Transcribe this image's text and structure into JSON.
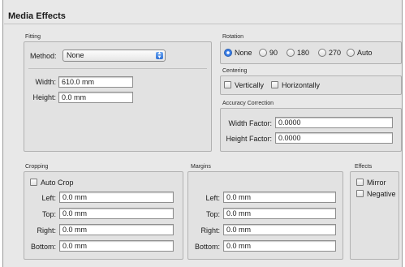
{
  "panel": {
    "title": "Media Effects"
  },
  "fitting": {
    "title": "Fitting",
    "method_label": "Method:",
    "method_value": "None",
    "width_label": "Width:",
    "width_value": "610.0 mm",
    "height_label": "Height:",
    "height_value": "0.0 mm"
  },
  "rotation": {
    "title": "Rotation",
    "options": [
      "None",
      "90",
      "180",
      "270",
      "Auto"
    ],
    "selected": "None"
  },
  "centering": {
    "title": "Centering",
    "vertically_label": "Vertically",
    "horizontally_label": "Horizontally"
  },
  "accuracy": {
    "title": "Accuracy Correction",
    "width_factor_label": "Width Factor:",
    "width_factor_value": "0.0000",
    "height_factor_label": "Height Factor:",
    "height_factor_value": "0.0000"
  },
  "cropping": {
    "title": "Cropping",
    "auto_crop_label": "Auto Crop",
    "left_label": "Left:",
    "left_value": "0.0 mm",
    "top_label": "Top:",
    "top_value": "0.0 mm",
    "right_label": "Right:",
    "right_value": "0.0 mm",
    "bottom_label": "Bottom:",
    "bottom_value": "0.0 mm"
  },
  "margins": {
    "title": "Margins",
    "left_label": "Left:",
    "left_value": "0.0 mm",
    "top_label": "Top:",
    "top_value": "0.0 mm",
    "right_label": "Right:",
    "right_value": "0.0 mm",
    "bottom_label": "Bottom:",
    "bottom_value": "0.0 mm"
  },
  "effects": {
    "title": "Effects",
    "mirror_label": "Mirror",
    "negative_label": "Negative"
  },
  "colors": {
    "accent": "#3b7ee6",
    "panel_bg": "#e8e8e8",
    "group_bg": "#e2e2e2"
  }
}
